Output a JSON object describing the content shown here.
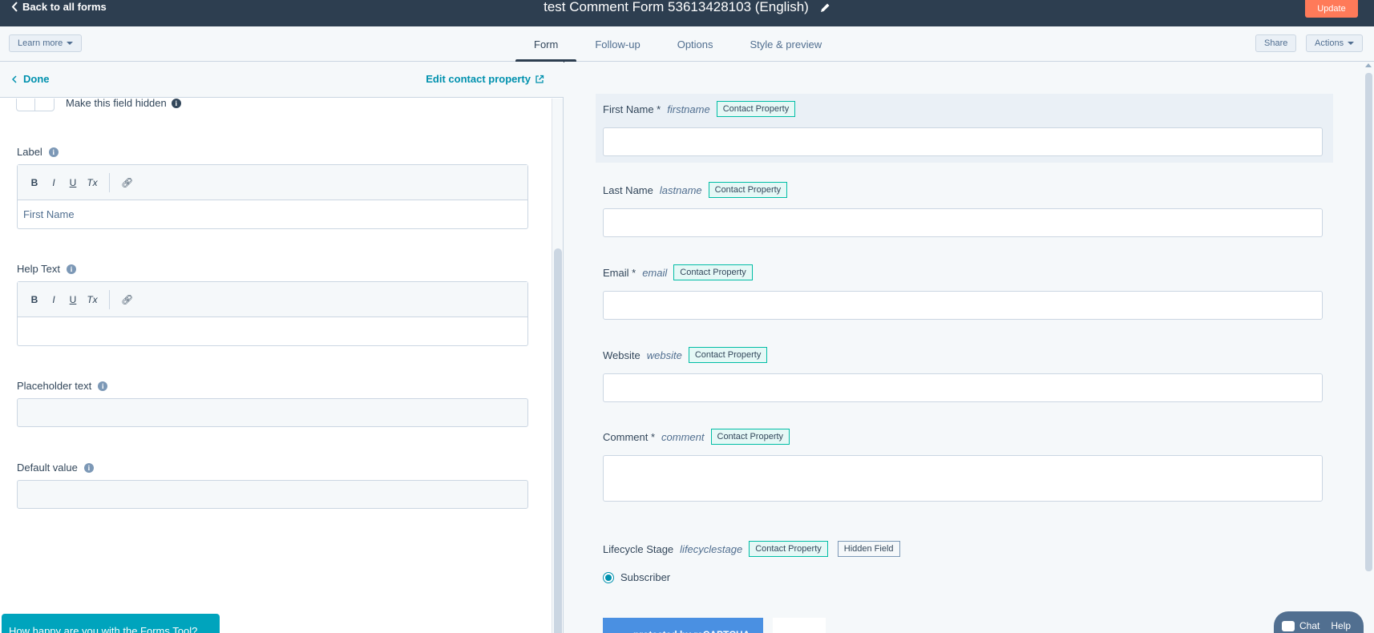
{
  "topbar": {
    "back_label": "Back to all forms",
    "form_title": "test Comment Form 53613428103 (English)",
    "update_label": "Update"
  },
  "tabbar": {
    "learn_more_label": "Learn more",
    "tabs": [
      "Form",
      "Follow-up",
      "Options",
      "Style & preview"
    ],
    "active_tab": "Form",
    "share_label": "Share",
    "actions_label": "Actions"
  },
  "editor": {
    "done_label": "Done",
    "edit_property_label": "Edit contact property",
    "hidden_field_label": "Make this field hidden",
    "label_title": "Label",
    "label_value": "First Name",
    "help_text_title": "Help Text",
    "help_text_value": "",
    "placeholder_title": "Placeholder text",
    "placeholder_value": "",
    "default_title": "Default value",
    "default_value": "",
    "toolbar": [
      "B",
      "I",
      "U",
      "Tx",
      "link"
    ],
    "survey_prompt": "How happy are you with the Forms Tool?"
  },
  "preview": {
    "fields": [
      {
        "label": "First Name *",
        "property": "firstname",
        "badge": "Contact Property",
        "selected": true
      },
      {
        "label": "Last Name",
        "property": "lastname",
        "badge": "Contact Property"
      },
      {
        "label": "Email *",
        "property": "email",
        "badge": "Contact Property"
      },
      {
        "label": "Website",
        "property": "website",
        "badge": "Contact Property"
      },
      {
        "label": "Comment *",
        "property": "comment",
        "badge": "Contact Property"
      },
      {
        "label": "Lifecycle Stage",
        "property": "lifecyclestage",
        "badge": "Contact Property",
        "badge2": "Hidden Field"
      }
    ],
    "radio_option": "Subscriber",
    "captcha_label": "protected by reCAPTCHA"
  },
  "widget": {
    "chat_label": "Chat",
    "help_label": "Help"
  },
  "colors": {
    "topbar_bg": "#2d3e50",
    "accent": "#0091ae",
    "update_btn": "#ff7a59",
    "badge_border": "#00bda5"
  }
}
